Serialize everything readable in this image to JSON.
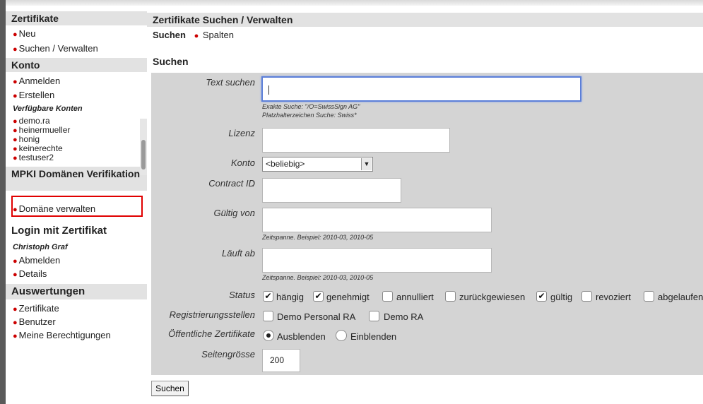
{
  "sidebar": {
    "zertifikate": {
      "heading": "Zertifikate",
      "items": [
        "Neu",
        "Suchen / Verwalten"
      ]
    },
    "konto": {
      "heading": "Konto",
      "items": [
        "Anmelden",
        "Erstellen"
      ],
      "sub_heading": "Verfügbare Konten",
      "accounts": [
        "demo.ra",
        "heinermueller",
        "honig",
        "keinerechte",
        "testuser2"
      ]
    },
    "mpki": {
      "heading": "MPKI Domänen Verifikation",
      "items": [
        "Domäne verwalten"
      ]
    },
    "login": {
      "heading": "Login mit Zertifikat",
      "user": "Christoph Graf",
      "items": [
        "Abmelden",
        "Details"
      ]
    },
    "auswertungen": {
      "heading": "Auswertungen",
      "items": [
        "Zertifikate",
        "Benutzer",
        "Meine Berechtigungen"
      ]
    }
  },
  "main": {
    "title": "Zertifikate Suchen / Verwalten",
    "subnav": {
      "active": "Suchen",
      "link": "Spalten"
    },
    "section_title": "Suchen",
    "form": {
      "text_suchen": {
        "label": "Text suchen",
        "value": "",
        "hint1": "Exakte Suche: \"/O=SwissSign AG\"",
        "hint2": "Platzhalterzeichen Suche: Swiss*"
      },
      "lizenz": {
        "label": "Lizenz",
        "value": ""
      },
      "konto": {
        "label": "Konto",
        "selected": "<beliebig>"
      },
      "contract_id": {
        "label": "Contract ID",
        "value": ""
      },
      "gueltig_von": {
        "label": "Gültig von",
        "value": "",
        "hint": "Zeitspanne. Beispiel: 2010-03, 2010-05"
      },
      "laeuft_ab": {
        "label": "Läuft ab",
        "value": "",
        "hint": "Zeitspanne. Beispiel: 2010-03, 2010-05"
      },
      "status": {
        "label": "Status",
        "options": [
          {
            "label": "hängig",
            "checked": true
          },
          {
            "label": "genehmigt",
            "checked": true
          },
          {
            "label": "annulliert",
            "checked": false
          },
          {
            "label": "zurückgewiesen",
            "checked": false
          },
          {
            "label": "gültig",
            "checked": true
          },
          {
            "label": "revoziert",
            "checked": false
          },
          {
            "label": "abgelaufen",
            "checked": false
          }
        ]
      },
      "registrierungsstellen": {
        "label": "Registrierungsstellen",
        "options": [
          {
            "label": "Demo Personal RA",
            "checked": false
          },
          {
            "label": "Demo RA",
            "checked": false
          }
        ]
      },
      "oeffentliche": {
        "label": "Öffentliche Zertifikate",
        "options": [
          {
            "label": "Ausblenden",
            "selected": true
          },
          {
            "label": "Einblenden",
            "selected": false
          }
        ]
      },
      "seitengroesse": {
        "label": "Seitengrösse",
        "value": "200"
      }
    },
    "submit_label": "Suchen"
  },
  "check_mark": "✔"
}
